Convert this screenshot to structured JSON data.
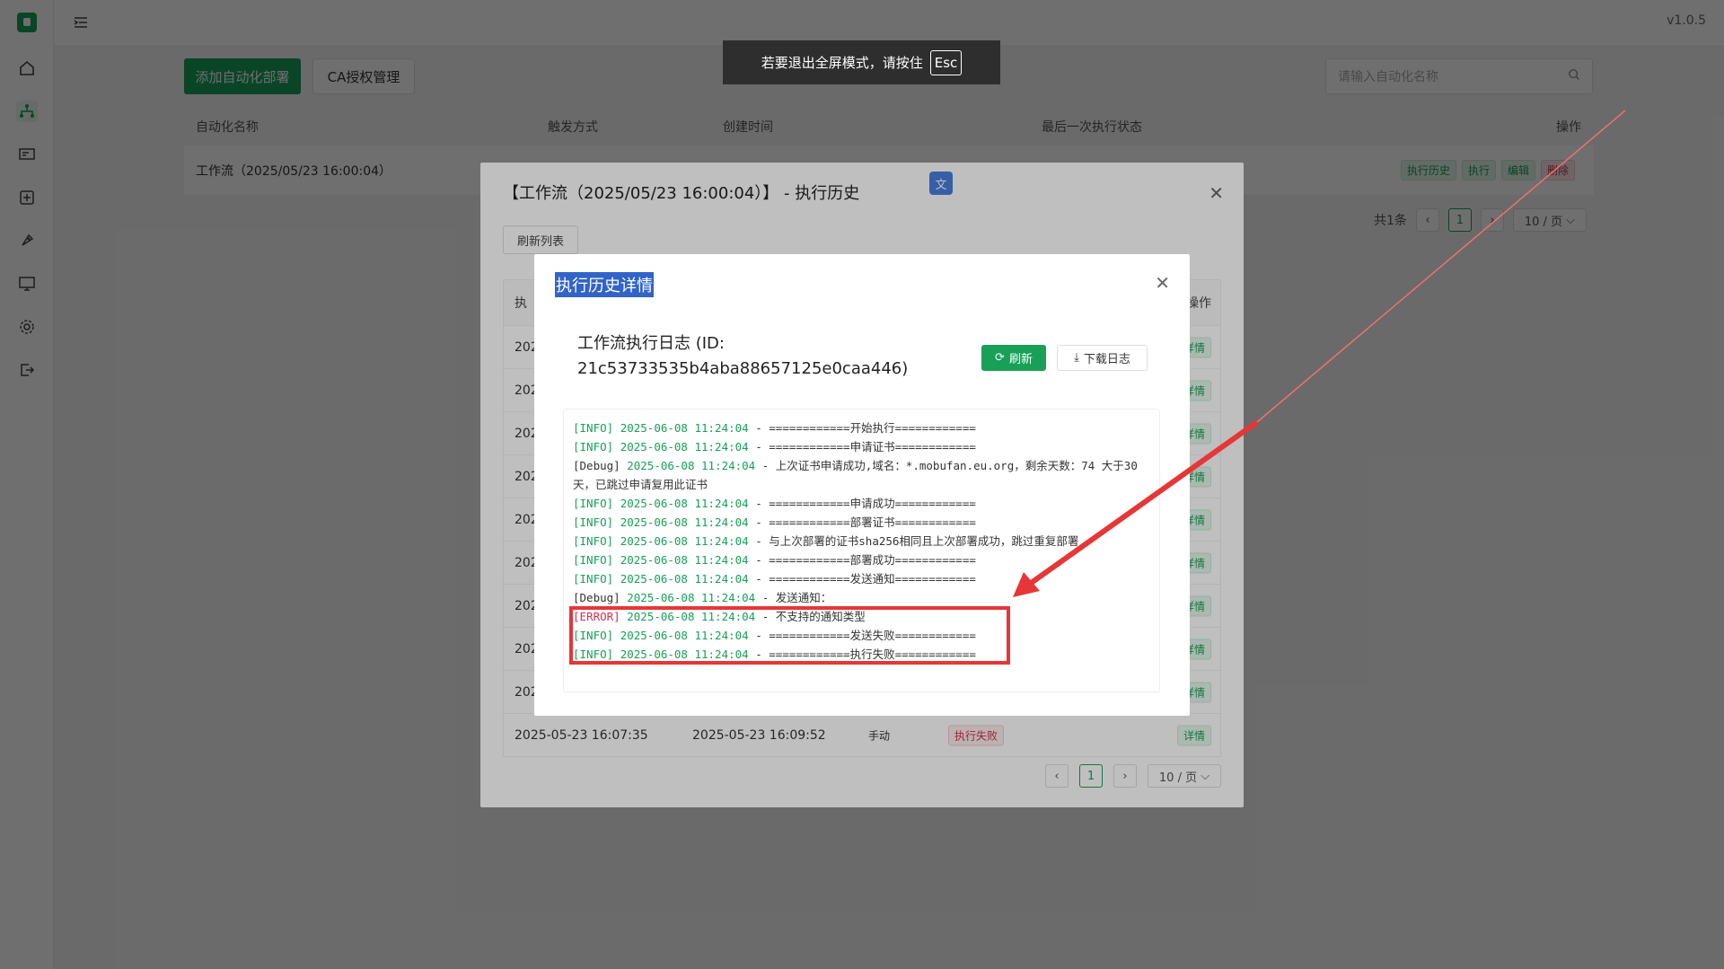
{
  "app": {
    "version": "v1.0.5"
  },
  "toolbar": {
    "add_button": "添加自动化部署",
    "ca_button": "CA授权管理",
    "search_placeholder": "请输入自动化名称"
  },
  "fullscreen_toast": {
    "text": "若要退出全屏模式，请按住",
    "key": "Esc"
  },
  "main_table": {
    "headers": [
      "自动化名称",
      "触发方式",
      "创建时间",
      "最后一次执行状态",
      "操作"
    ],
    "rows": [
      {
        "name": "工作流（2025/05/23 16:00:04）",
        "actions": [
          "执行历史",
          "执行",
          "编辑",
          "删除"
        ]
      }
    ],
    "pager": {
      "total": "共1条",
      "page": "1",
      "page_size": "10 / 页"
    }
  },
  "history_modal": {
    "title": "【工作流（2025/05/23 16:00:04）】 - 执行历史",
    "refresh_button": "刷新列表",
    "header_first": "执",
    "header_last": "操作",
    "row_prefix": "202",
    "row_action": "详情",
    "last_row": {
      "start": "2025-05-23 16:07:35",
      "end": "2025-05-23 16:09:52",
      "trigger": "手动",
      "status": "执行失败",
      "action": "详情"
    },
    "pager": {
      "page": "1",
      "page_size": "10 / 页"
    }
  },
  "detail_modal": {
    "title": "执行历史详情",
    "log_heading": "工作流执行日志 (ID:",
    "log_id": "21c53733535b4aba88657125e0caa446)",
    "refresh_button": "刷新",
    "download_button": "下载日志",
    "logs": [
      {
        "level": "[INFO]",
        "time": "2025-06-08 11:24:04",
        "msg": " - ============开始执行============"
      },
      {
        "level": "[INFO]",
        "time": "2025-06-08 11:24:04",
        "msg": " - ============申请证书============"
      },
      {
        "level": "[Debug]",
        "time": "2025-06-08 11:24:04",
        "msg": " - 上次证书申请成功,域名：*.mobufan.eu.org，剩余天数：74 大于30天，已跳过申请复用此证书"
      },
      {
        "level": "[INFO]",
        "time": "2025-06-08 11:24:04",
        "msg": " - ============申请成功============"
      },
      {
        "level": "[INFO]",
        "time": "2025-06-08 11:24:04",
        "msg": " - ============部署证书============"
      },
      {
        "level": "[INFO]",
        "time": "2025-06-08 11:24:04",
        "msg": " - 与上次部署的证书sha256相同且上次部署成功，跳过重复部署"
      },
      {
        "level": "[INFO]",
        "time": "2025-06-08 11:24:04",
        "msg": " - ============部署成功============"
      },
      {
        "level": "[INFO]",
        "time": "2025-06-08 11:24:04",
        "msg": " - ============发送通知============"
      },
      {
        "level": "[Debug]",
        "time": "2025-06-08 11:24:04",
        "msg": " - 发送通知："
      },
      {
        "level": "[ERROR]",
        "time": "2025-06-08 11:24:04",
        "msg": " - 不支持的通知类型"
      },
      {
        "level": "[INFO]",
        "time": "2025-06-08 11:24:04",
        "msg": " - ============发送失败============"
      },
      {
        "level": "[INFO]",
        "time": "2025-06-08 11:24:04",
        "msg": " - ============执行失败============"
      }
    ]
  },
  "colors": {
    "brand_green": "#18a058",
    "error_red": "#d03050",
    "annotation_red": "#e63636"
  }
}
